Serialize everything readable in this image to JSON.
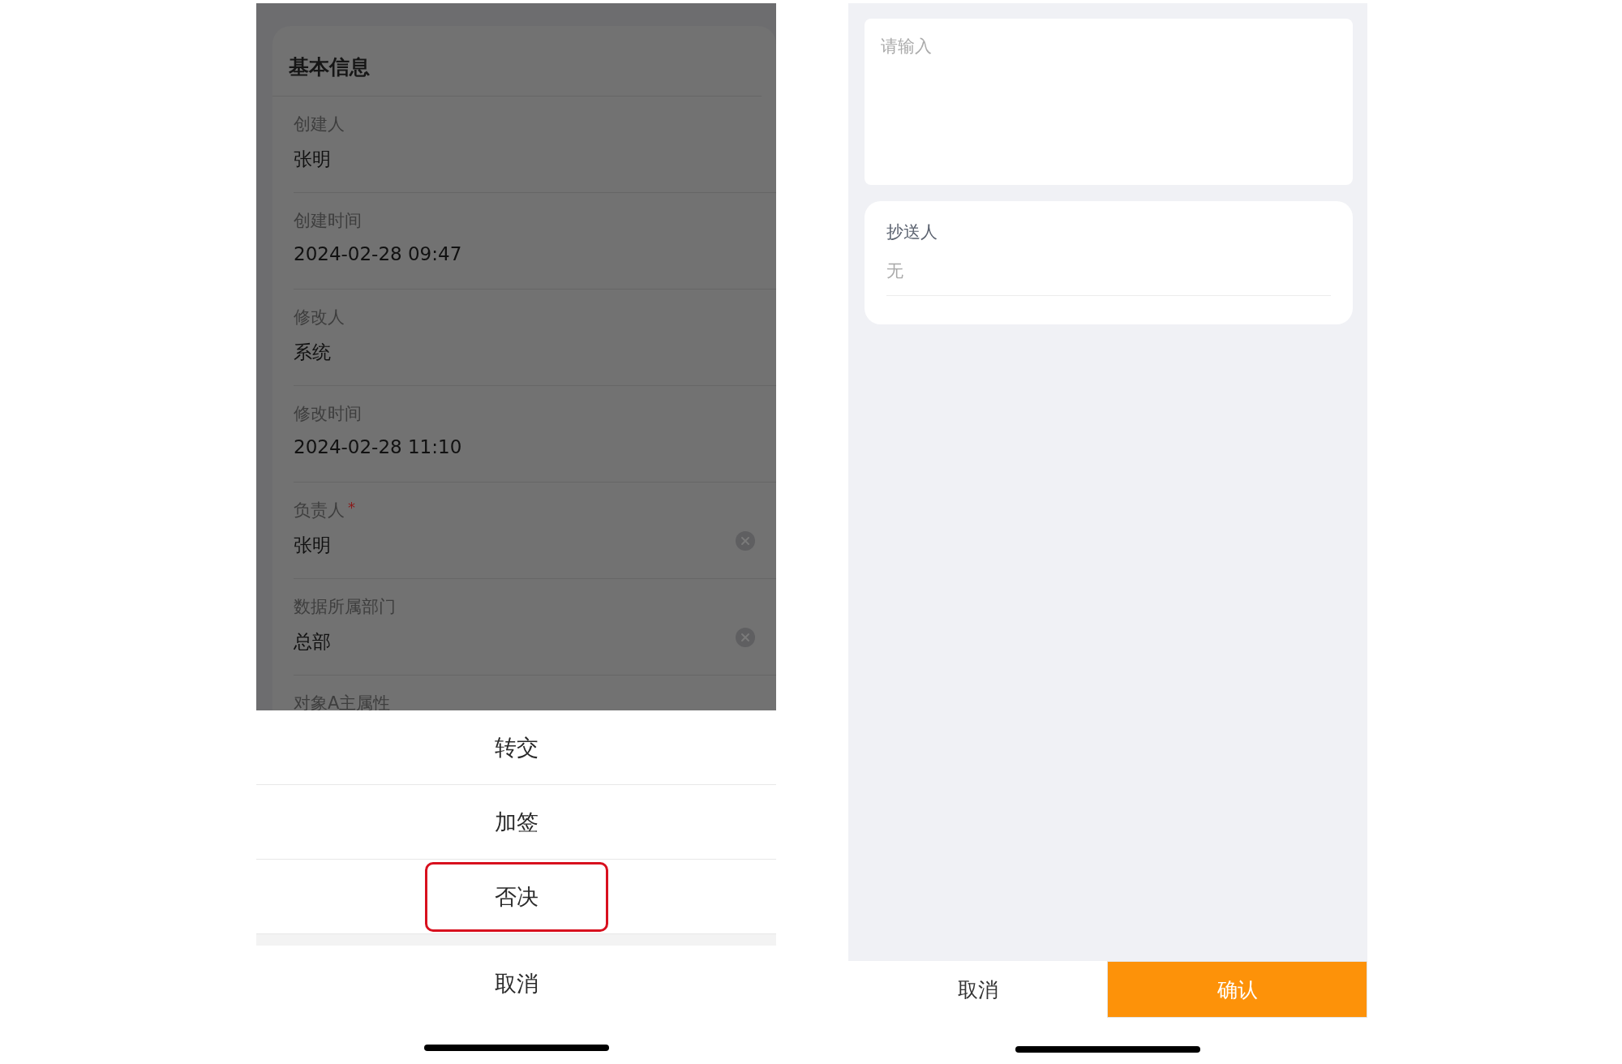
{
  "detail": {
    "title": "基本信息",
    "fields": [
      {
        "label": "创建人",
        "value": "张明",
        "clearable": false
      },
      {
        "label": "创建时间",
        "value": "2024-02-28 09:47",
        "clearable": false
      },
      {
        "label": "修改人",
        "value": "系统",
        "clearable": false
      },
      {
        "label": "修改时间",
        "value": "2024-02-28 11:10",
        "clearable": false
      },
      {
        "label": "负责人",
        "required_mark": "*",
        "value": "张明",
        "clearable": true
      },
      {
        "label": "数据所属部门",
        "value": "总部",
        "clearable": true
      },
      {
        "label": "对象A主属性",
        "clearable": false
      }
    ]
  },
  "action_sheet": {
    "actions": [
      {
        "label": "转交",
        "highlighted": false
      },
      {
        "label": "加签",
        "highlighted": false
      },
      {
        "label": "否决",
        "highlighted": true
      }
    ],
    "cancel": "取消"
  },
  "approval_form": {
    "comment": {
      "placeholder": "请输入"
    },
    "cc": {
      "label": "抄送人",
      "value": "无"
    },
    "buttons": [
      {
        "label": "取消",
        "kind": "secondary"
      },
      {
        "label": "确认",
        "kind": "primary"
      }
    ]
  }
}
